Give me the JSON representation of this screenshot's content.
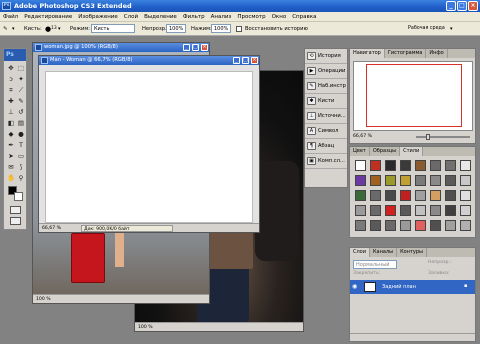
{
  "app": {
    "title": "Adobe Photoshop CS3 Extended",
    "logo": "Ps"
  },
  "menu": [
    "Файл",
    "Редактирование",
    "Изображение",
    "Слой",
    "Выделение",
    "Фильтр",
    "Анализ",
    "Просмотр",
    "Окно",
    "Справка"
  ],
  "options": {
    "brush_label": "Кисть:",
    "brush_size": "13",
    "mode_label": "Режим:",
    "mode_value": "Кисть",
    "opacity_label": "Непрозр.:",
    "opacity_value": "100%",
    "pressure_label": "Нажим:",
    "pressure_value": "100%",
    "restore_label": "Восстановить историю",
    "workspace_label": "Рабочая среда"
  },
  "toolbox": {
    "logo": "Ps"
  },
  "documents": {
    "woman": {
      "title": "woman.jpg @ 100% (RGB/8)",
      "zoom": "100 %"
    },
    "man": {
      "title": "Man - Woman @ 66,7% (RGB/8)",
      "zoom": "66,67 %",
      "doc_info": "Док: 900,0K/0 байт"
    },
    "photo": {
      "zoom": "100 %"
    }
  },
  "dock": {
    "items": [
      {
        "label": "История",
        "icon": "history-icon"
      },
      {
        "label": "Операции",
        "icon": "actions-icon"
      },
      {
        "label": "Наб.инстр",
        "icon": "tool-presets-icon"
      },
      {
        "label": "Кисти",
        "icon": "brushes-icon"
      },
      {
        "label": "Источни...",
        "icon": "clone-source-icon"
      },
      {
        "label": "Символ",
        "icon": "character-icon"
      },
      {
        "label": "Абзац",
        "icon": "paragraph-icon"
      },
      {
        "label": "Комп.сл...",
        "icon": "layer-comps-icon"
      }
    ]
  },
  "navigator": {
    "tabs": [
      "Навигатор",
      "Гистограмма",
      "Инфо"
    ],
    "zoom": "66,67 %",
    "frame_color": "#d9302a"
  },
  "styles": {
    "tabs": [
      "Цвет",
      "Образцы",
      "Стили"
    ]
  },
  "layers": {
    "tabs": [
      "Слои",
      "Каналы",
      "Контуры"
    ],
    "blend_mode": "Нормальный",
    "opacity_label": "Непрозр.:",
    "lock_label": "Закрепить:",
    "fill_label": "Заливка:",
    "layer_name": "Задний план",
    "accent": "#3166c5"
  }
}
